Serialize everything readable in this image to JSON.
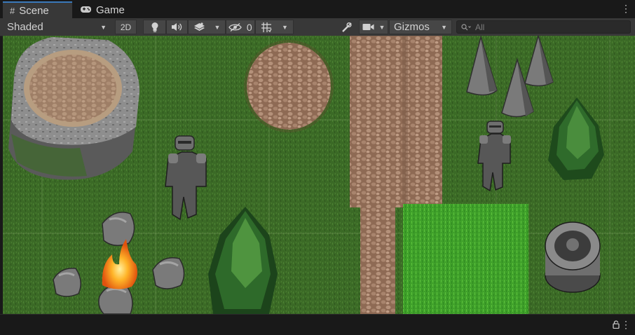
{
  "tabs": [
    {
      "label": "Scene",
      "icon": "grid-icon",
      "active": true
    },
    {
      "label": "Game",
      "icon": "gamepad-icon",
      "active": false
    }
  ],
  "toolbar": {
    "shading_mode": "Shaded",
    "mode_2d_label": "2D",
    "hidden_count": "0",
    "gizmos_label": "Gizmos",
    "search_placeholder": "All"
  },
  "colors": {
    "tab_accent": "#3a79bb",
    "grass": "#3b6a26",
    "dirt_path": "#a07a5e",
    "bright_grass": "#43a12a",
    "stone": "#7e7e7e"
  },
  "scene_objects": [
    "rock-plateau",
    "dirt-patch",
    "dirt-path",
    "rock-spire",
    "stone-knight",
    "pine-tree",
    "bright-grass-patch",
    "boulder",
    "campfire",
    "stone-well"
  ]
}
